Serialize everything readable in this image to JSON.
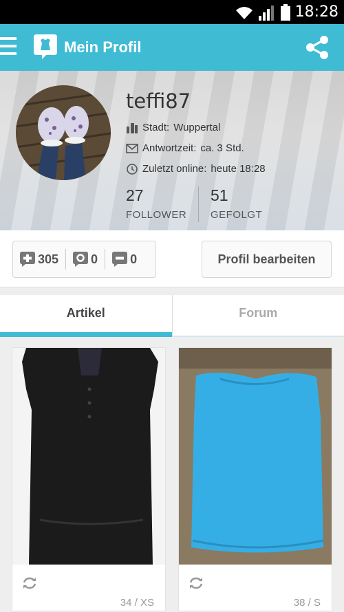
{
  "status_bar": {
    "time": "18:28"
  },
  "app_bar": {
    "title": "Mein Profil"
  },
  "profile": {
    "username": "teffi87",
    "city_label": "Stadt:",
    "city": "Wuppertal",
    "response_label": "Antwortzeit:",
    "response": "ca. 3 Std.",
    "last_online_label": "Zuletzt online:",
    "last_online": "heute 18:28",
    "followers_count": "27",
    "followers_label": "FOLLOWER",
    "following_count": "51",
    "following_label": "GEFOLGT"
  },
  "ratings": {
    "positive": "305",
    "neutral": "0",
    "negative": "0"
  },
  "edit_button": "Profil bearbeiten",
  "tabs": [
    {
      "label": "Artikel",
      "active": true
    },
    {
      "label": "Forum",
      "active": false
    }
  ],
  "items": [
    {
      "size": "34 / XS",
      "color": "#1b1b1b"
    },
    {
      "size": "38 / S",
      "color": "#35aee6"
    }
  ],
  "colors": {
    "accent": "#3fbcd4"
  }
}
